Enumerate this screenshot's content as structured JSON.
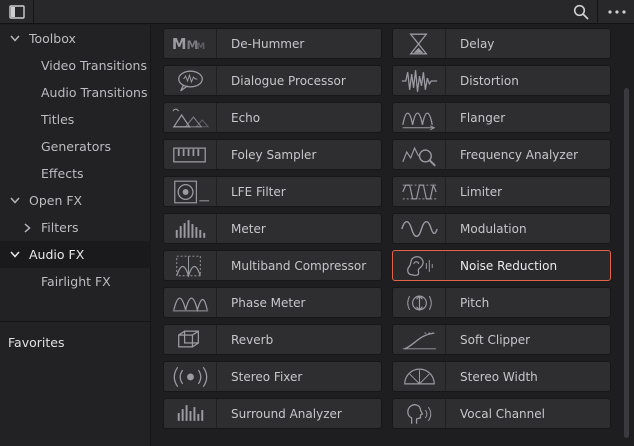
{
  "sidebar": {
    "items": [
      {
        "label": "Toolbox",
        "level": 0,
        "chevron": "down",
        "selected": false
      },
      {
        "label": "Video Transitions",
        "level": 1,
        "chevron": "",
        "selected": false
      },
      {
        "label": "Audio Transitions",
        "level": 1,
        "chevron": "",
        "selected": false
      },
      {
        "label": "Titles",
        "level": 1,
        "chevron": "",
        "selected": false
      },
      {
        "label": "Generators",
        "level": 1,
        "chevron": "",
        "selected": false
      },
      {
        "label": "Effects",
        "level": 1,
        "chevron": "",
        "selected": false
      },
      {
        "label": "Open FX",
        "level": 0,
        "chevron": "down",
        "selected": false
      },
      {
        "label": "Filters",
        "level": 1,
        "chevron": "right",
        "selected": false
      },
      {
        "label": "Audio FX",
        "level": 0,
        "chevron": "down",
        "selected": true
      },
      {
        "label": "Fairlight FX",
        "level": 1,
        "chevron": "",
        "selected": false
      }
    ],
    "favorites_label": "Favorites"
  },
  "topbar": {
    "icons": [
      "panel-toggle-icon",
      "search-icon",
      "more-options-icon"
    ]
  },
  "effects": {
    "left": [
      {
        "label": "De-Hummer",
        "icon": "de-hummer-icon"
      },
      {
        "label": "Dialogue Processor",
        "icon": "dialogue-processor-icon"
      },
      {
        "label": "Echo",
        "icon": "echo-icon"
      },
      {
        "label": "Foley Sampler",
        "icon": "foley-sampler-icon"
      },
      {
        "label": "LFE Filter",
        "icon": "lfe-filter-icon"
      },
      {
        "label": "Meter",
        "icon": "meter-icon"
      },
      {
        "label": "Multiband Compressor",
        "icon": "multiband-compressor-icon"
      },
      {
        "label": "Phase Meter",
        "icon": "phase-meter-icon"
      },
      {
        "label": "Reverb",
        "icon": "reverb-icon"
      },
      {
        "label": "Stereo Fixer",
        "icon": "stereo-fixer-icon"
      },
      {
        "label": "Surround Analyzer",
        "icon": "surround-analyzer-icon"
      }
    ],
    "right": [
      {
        "label": "Delay",
        "icon": "delay-icon"
      },
      {
        "label": "Distortion",
        "icon": "distortion-icon"
      },
      {
        "label": "Flanger",
        "icon": "flanger-icon"
      },
      {
        "label": "Frequency Analyzer",
        "icon": "frequency-analyzer-icon"
      },
      {
        "label": "Limiter",
        "icon": "limiter-icon"
      },
      {
        "label": "Modulation",
        "icon": "modulation-icon"
      },
      {
        "label": "Noise Reduction",
        "icon": "noise-reduction-icon"
      },
      {
        "label": "Pitch",
        "icon": "pitch-icon"
      },
      {
        "label": "Soft Clipper",
        "icon": "soft-clipper-icon"
      },
      {
        "label": "Stereo Width",
        "icon": "stereo-width-icon"
      },
      {
        "label": "Vocal Channel",
        "icon": "vocal-channel-icon"
      }
    ],
    "selected": "Noise Reduction"
  },
  "colors": {
    "selection_outline": "#e2614a",
    "button_bg": "#2e2e31",
    "background": "#1e1e21"
  }
}
